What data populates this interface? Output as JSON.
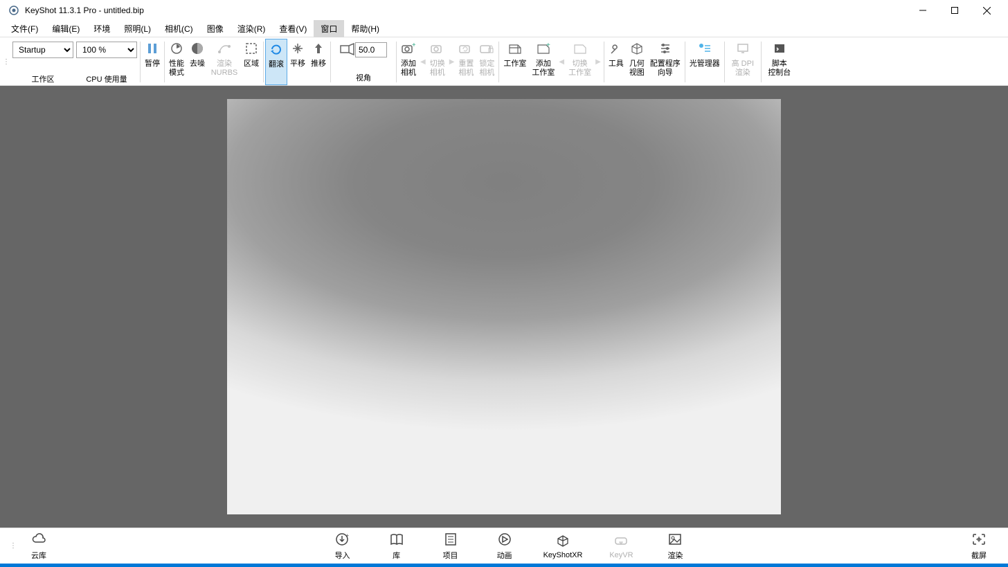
{
  "title": "KeyShot 11.3.1 Pro  - untitled.bip",
  "menu": {
    "file": "文件(F)",
    "edit": "编辑(E)",
    "environment": "环境",
    "lighting": "照明(L)",
    "camera": "相机(C)",
    "image": "图像",
    "render": "渲染(R)",
    "view": "查看(V)",
    "window": "窗口",
    "help": "帮助(H)"
  },
  "workspace": {
    "value": "Startup",
    "label": "工作区"
  },
  "zoom": {
    "value": "100 %",
    "label": "CPU 使用量"
  },
  "tb": {
    "pause": "暂停",
    "perfmode": "性能\n模式",
    "denoise": "去噪",
    "renderNurbs": "渲染\nNURBS",
    "region": "区域",
    "tumble": "翻滚",
    "pan": "平移",
    "dolly": "推移",
    "perspective": "视角",
    "persp_value": "50.0",
    "addCamera": "添加\n相机",
    "switchCamera": "切换\n相机",
    "resetCamera": "重置\n相机",
    "lockCamera": "锁定\n相机",
    "studio": "工作室",
    "addStudio": "添加\n工作室",
    "switchStudio": "切换\n工作室",
    "tools": "工具",
    "geomView": "几何\n视图",
    "configWiz": "配置程序\n向导",
    "lightMgr": "光管理器",
    "hiDpiRender": "高 DPI\n渲染",
    "scriptConsole": "脚本\n控制台"
  },
  "bottom": {
    "cloud": "云库",
    "import": "导入",
    "library": "库",
    "project": "项目",
    "animation": "动画",
    "keyshotxr": "KeyShotXR",
    "keyvr": "KeyVR",
    "render": "渲染",
    "screenshot": "截屏"
  }
}
